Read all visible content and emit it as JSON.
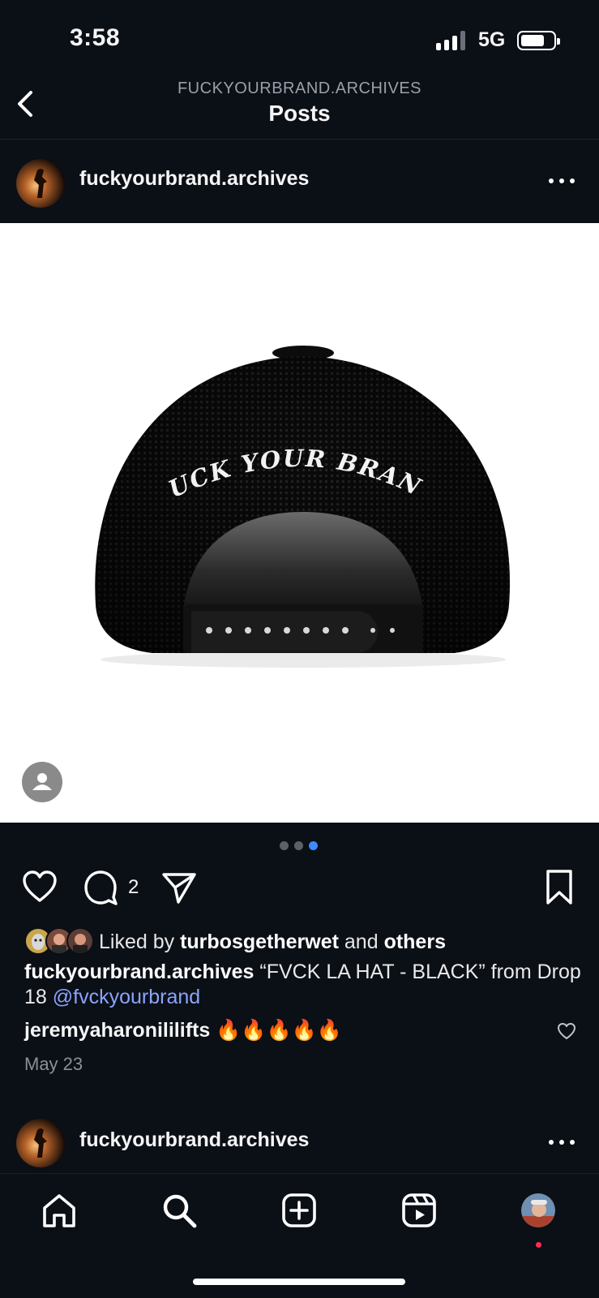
{
  "status_bar": {
    "time": "3:58",
    "network": "5G",
    "signal_bars": 3,
    "signal_max": 4
  },
  "header": {
    "subtitle": "FUCKYOURBRAND.ARCHIVES",
    "title": "Posts"
  },
  "post": {
    "username": "fuckyourbrand.archives",
    "image": {
      "subject": "black mesh trucker hat, back view",
      "embroidery": "FUCK YOUR BRAND"
    },
    "carousel": {
      "count": 3,
      "active_index": 2
    },
    "comment_count": "2",
    "likes": {
      "prefix": "Liked by",
      "user": "turbosgetherwet",
      "middle": "and",
      "others": "others"
    },
    "caption": {
      "username": "fuckyourbrand.archives",
      "text": "“FVCK LA HAT - BLACK” from Drop 18",
      "mention": "@fvckyourbrand"
    },
    "top_comment": {
      "username": "jeremyaharonililifts",
      "text": "🔥🔥🔥🔥🔥"
    },
    "date": "May 23"
  },
  "next_post": {
    "username": "fuckyourbrand.archives"
  },
  "tab_bar": {
    "items": [
      "home-icon",
      "search-icon",
      "create-icon",
      "reels-icon",
      "profile-avatar"
    ]
  },
  "colors": {
    "background": "#0b0f16",
    "accent_blue": "#3b8cff",
    "mention": "#8aa4ff",
    "notification": "#ff2d55"
  }
}
